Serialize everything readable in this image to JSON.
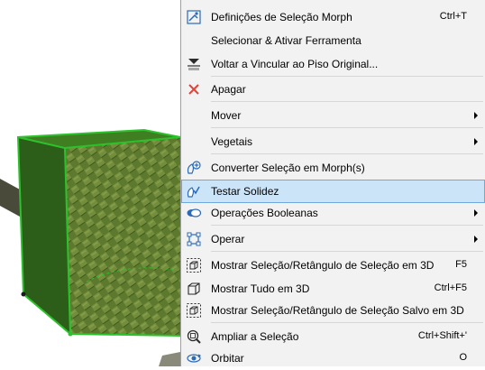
{
  "menu": {
    "items": [
      {
        "icon": "morph-settings-icon",
        "label": "Definições de Seleção Morph",
        "shortcut": "Ctrl+T"
      },
      {
        "icon": "",
        "label": "Selecionar & Ativar Ferramenta",
        "shortcut": ""
      },
      {
        "icon": "relink-floor-icon",
        "label": "Voltar a Vincular ao Piso Original...",
        "shortcut": ""
      },
      {
        "icon": "delete-icon",
        "label": "Apagar",
        "shortcut": ""
      },
      {
        "icon": "",
        "label": "Mover",
        "shortcut": ""
      },
      {
        "icon": "",
        "label": "Vegetais",
        "shortcut": ""
      },
      {
        "icon": "convert-morph-icon",
        "label": "Converter Seleção em Morph(s)",
        "shortcut": ""
      },
      {
        "icon": "check-solidity-icon",
        "label": "Testar Solidez",
        "shortcut": ""
      },
      {
        "icon": "boolean-operations-icon",
        "label": "Operações Booleanas",
        "shortcut": ""
      },
      {
        "icon": "operate-icon",
        "label": "Operar",
        "shortcut": ""
      },
      {
        "icon": "show-selection-3d-icon",
        "label": "Mostrar Seleção/Retângulo de Seleção em 3D",
        "shortcut": "F5"
      },
      {
        "icon": "show-all-3d-icon",
        "label": "Mostrar Tudo em 3D",
        "shortcut": "Ctrl+F5"
      },
      {
        "icon": "show-saved-selection-3d-icon",
        "label": "Mostrar Seleção/Retângulo de Seleção Salvo em 3D",
        "shortcut": ""
      },
      {
        "icon": "zoom-selection-icon",
        "label": "Ampliar a Seleção",
        "shortcut": "Ctrl+Shift+'"
      },
      {
        "icon": "orbit-icon",
        "label": "Orbitar",
        "shortcut": "O"
      }
    ]
  },
  "colors": {
    "menu_bg": "#f2f2f2",
    "highlight_bg": "#cce4f7",
    "highlight_border": "#6fa8dc",
    "selection_green": "#2cc22c",
    "delete_red": "#e0453a"
  }
}
